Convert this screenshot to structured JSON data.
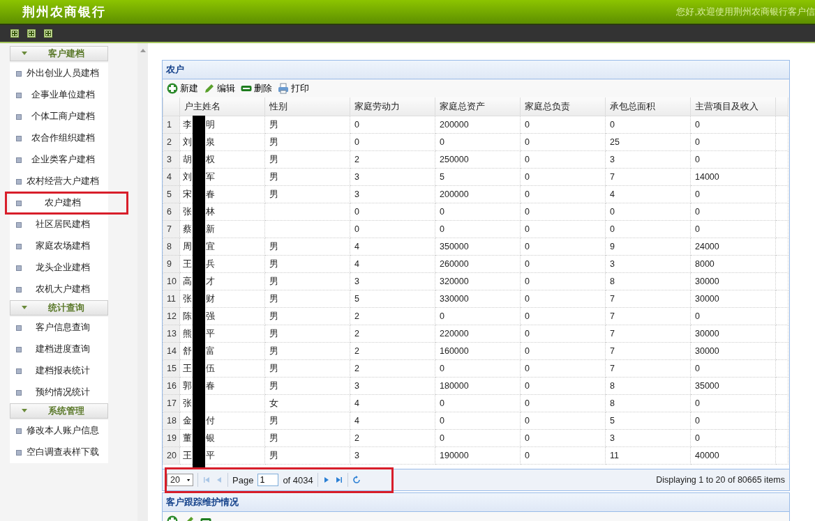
{
  "header": {
    "title": "荆州农商银行",
    "greeting": "您好,欢迎使用荆州农商银行客户信"
  },
  "sidebar": {
    "groups": [
      {
        "title": "客户建档",
        "expanded": true,
        "items": [
          {
            "label": "外出创业人员建档",
            "highlighted": false
          },
          {
            "label": "企事业单位建档",
            "highlighted": false
          },
          {
            "label": "个体工商户建档",
            "highlighted": false
          },
          {
            "label": "农合作组织建档",
            "highlighted": false
          },
          {
            "label": "企业类客户建档",
            "highlighted": false
          },
          {
            "label": "农村经营大户建档",
            "highlighted": false
          },
          {
            "label": "农户建档",
            "highlighted": true
          },
          {
            "label": "社区居民建档",
            "highlighted": false
          },
          {
            "label": "家庭农场建档",
            "highlighted": false
          },
          {
            "label": "龙头企业建档",
            "highlighted": false
          },
          {
            "label": "农机大户建档",
            "highlighted": false
          }
        ]
      },
      {
        "title": "统计查询",
        "expanded": true,
        "items": [
          {
            "label": "客户信息查询",
            "highlighted": false
          },
          {
            "label": "建档进度查询",
            "highlighted": false
          },
          {
            "label": "建档报表统计",
            "highlighted": false
          },
          {
            "label": "预约情况统计",
            "highlighted": false
          }
        ]
      },
      {
        "title": "系统管理",
        "expanded": true,
        "items": [
          {
            "label": "修改本人账户信息",
            "highlighted": false
          },
          {
            "label": "空白调查表样下载",
            "highlighted": false
          }
        ]
      }
    ]
  },
  "panel": {
    "title": "农户",
    "actions": [
      {
        "kind": "add",
        "label": "新建"
      },
      {
        "kind": "edit",
        "label": "编辑"
      },
      {
        "kind": "delete",
        "label": "删除"
      },
      {
        "kind": "print",
        "label": "打印"
      }
    ],
    "table": {
      "columns": [
        "户主姓名",
        "性别",
        "家庭劳动力",
        "家庭总资产",
        "家庭总负责",
        "承包总面积",
        "主营项目及收入"
      ],
      "rows": [
        {
          "n": "1",
          "name": [
            "李",
            "明"
          ],
          "gender": "男",
          "values": [
            "0",
            "200000",
            "0",
            "0",
            "0"
          ]
        },
        {
          "n": "2",
          "name": [
            "刘",
            "泉"
          ],
          "gender": "男",
          "values": [
            "0",
            "0",
            "0",
            "25",
            "0"
          ]
        },
        {
          "n": "3",
          "name": [
            "胡",
            "权"
          ],
          "gender": "男",
          "values": [
            "2",
            "250000",
            "0",
            "3",
            "0"
          ]
        },
        {
          "n": "4",
          "name": [
            "刘",
            "军"
          ],
          "gender": "男",
          "values": [
            "3",
            "5",
            "0",
            "7",
            "14000"
          ]
        },
        {
          "n": "5",
          "name": [
            "宋",
            "春"
          ],
          "gender": "男",
          "values": [
            "3",
            "200000",
            "0",
            "4",
            "0"
          ]
        },
        {
          "n": "6",
          "name": [
            "张",
            "林"
          ],
          "values": [
            "0",
            "0",
            "0",
            "0",
            "0"
          ]
        },
        {
          "n": "7",
          "name": [
            "蔡",
            "新"
          ],
          "values": [
            "0",
            "0",
            "0",
            "0",
            "0"
          ]
        },
        {
          "n": "8",
          "name": [
            "周",
            "宜"
          ],
          "gender": "男",
          "values": [
            "4",
            "350000",
            "0",
            "9",
            "24000"
          ]
        },
        {
          "n": "9",
          "name": [
            "王",
            "兵"
          ],
          "gender": "男",
          "values": [
            "4",
            "260000",
            "0",
            "3",
            "8000"
          ]
        },
        {
          "n": "10",
          "name": [
            "高",
            "才"
          ],
          "gender": "男",
          "values": [
            "3",
            "320000",
            "0",
            "8",
            "30000"
          ]
        },
        {
          "n": "11",
          "name": [
            "张",
            "财"
          ],
          "gender": "男",
          "values": [
            "5",
            "330000",
            "0",
            "7",
            "30000"
          ]
        },
        {
          "n": "12",
          "name": [
            "陈",
            "强"
          ],
          "gender": "男",
          "values": [
            "2",
            "0",
            "0",
            "7",
            "0"
          ]
        },
        {
          "n": "13",
          "name": [
            "熊",
            "平"
          ],
          "gender": "男",
          "values": [
            "2",
            "220000",
            "0",
            "7",
            "30000"
          ]
        },
        {
          "n": "14",
          "name": [
            "舒",
            "富"
          ],
          "gender": "男",
          "values": [
            "2",
            "160000",
            "0",
            "7",
            "30000"
          ]
        },
        {
          "n": "15",
          "name": [
            "王",
            "伍"
          ],
          "gender": "男",
          "values": [
            "2",
            "0",
            "0",
            "7",
            "0"
          ]
        },
        {
          "n": "16",
          "name": [
            "郭",
            "春"
          ],
          "gender": "男",
          "values": [
            "3",
            "180000",
            "0",
            "8",
            "35000"
          ]
        },
        {
          "n": "17",
          "name": [
            "张"
          ],
          "gender": "女",
          "values": [
            "4",
            "0",
            "0",
            "8",
            "0"
          ]
        },
        {
          "n": "18",
          "name": [
            "金",
            "付"
          ],
          "gender": "男",
          "values": [
            "4",
            "0",
            "0",
            "5",
            "0"
          ]
        },
        {
          "n": "19",
          "name": [
            "董",
            "银"
          ],
          "gender": "男",
          "values": [
            "2",
            "0",
            "0",
            "3",
            "0"
          ]
        },
        {
          "n": "20",
          "name": [
            "王",
            "平"
          ],
          "gender": "男",
          "values": [
            "3",
            "190000",
            "0",
            "11",
            "40000"
          ]
        }
      ]
    },
    "pager": {
      "highlighted": true,
      "page_size": "20",
      "page_label": "Page",
      "page": "1",
      "of": "of 4034",
      "summary": "Displaying 1 to 20 of 80665 items"
    }
  },
  "panel2": {
    "title": "客户跟踪维护情况",
    "actions": [
      {
        "kind": "add"
      },
      {
        "kind": "edit"
      },
      {
        "kind": "delete"
      }
    ]
  }
}
